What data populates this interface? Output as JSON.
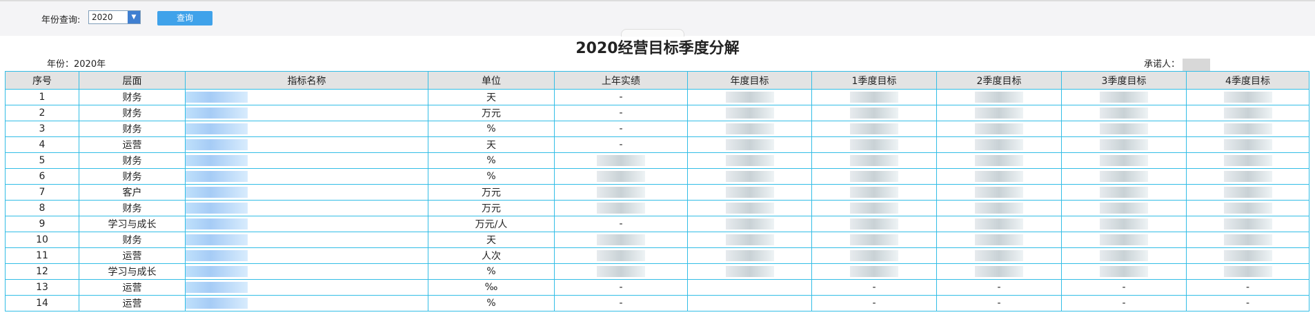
{
  "query": {
    "label": "年份查询:",
    "year_value": "2020",
    "button_label": "查询"
  },
  "report": {
    "title": "2020经营目标季度分解",
    "year_label": "年份：2020年",
    "owner_label": "承诺人："
  },
  "table": {
    "headers": [
      "序号",
      "层面",
      "指标名称",
      "单位",
      "上年实绩",
      "年度目标",
      "1季度目标",
      "2季度目标",
      "3季度目标",
      "4季度目标"
    ],
    "rows": [
      {
        "no": "1",
        "layer": "财务",
        "unit": "天",
        "last": "-",
        "q1": "",
        "q2": "",
        "q3": "",
        "q4": ""
      },
      {
        "no": "2",
        "layer": "财务",
        "unit": "万元",
        "last": "-",
        "q1": "",
        "q2": "",
        "q3": "",
        "q4": ""
      },
      {
        "no": "3",
        "layer": "财务",
        "unit": "%",
        "last": "-",
        "q1": "",
        "q2": "",
        "q3": "",
        "q4": ""
      },
      {
        "no": "4",
        "layer": "运营",
        "unit": "天",
        "last": "-",
        "q1": "",
        "q2": "",
        "q3": "",
        "q4": ""
      },
      {
        "no": "5",
        "layer": "财务",
        "unit": "%",
        "last": "",
        "q1": "",
        "q2": "",
        "q3": "",
        "q4": ""
      },
      {
        "no": "6",
        "layer": "财务",
        "unit": "%",
        "last": "",
        "q1": "",
        "q2": "",
        "q3": "",
        "q4": ""
      },
      {
        "no": "7",
        "layer": "客户",
        "unit": "万元",
        "last": "",
        "q1": "",
        "q2": "",
        "q3": "",
        "q4": ""
      },
      {
        "no": "8",
        "layer": "财务",
        "unit": "万元",
        "last": "",
        "q1": "",
        "q2": "",
        "q3": "",
        "q4": ""
      },
      {
        "no": "9",
        "layer": "学习与成长",
        "unit": "万元/人",
        "last": "-",
        "q1": "",
        "q2": "",
        "q3": "",
        "q4": ""
      },
      {
        "no": "10",
        "layer": "财务",
        "unit": "天",
        "last": "",
        "q1": "",
        "q2": "",
        "q3": "",
        "q4": ""
      },
      {
        "no": "11",
        "layer": "运营",
        "unit": "人次",
        "last": "",
        "q1": "",
        "q2": "",
        "q3": "",
        "q4": ""
      },
      {
        "no": "12",
        "layer": "学习与成长",
        "unit": "%",
        "last": "",
        "q1": "",
        "q2": "",
        "q3": "",
        "q4": ""
      },
      {
        "no": "13",
        "layer": "运营",
        "unit": "‰",
        "last": "-",
        "q1": "-",
        "q2": "-",
        "q3": "-",
        "q4": "-"
      },
      {
        "no": "14",
        "layer": "运营",
        "unit": "%",
        "last": "-",
        "q1": "-",
        "q2": "-",
        "q3": "-",
        "q4": "-"
      }
    ]
  }
}
